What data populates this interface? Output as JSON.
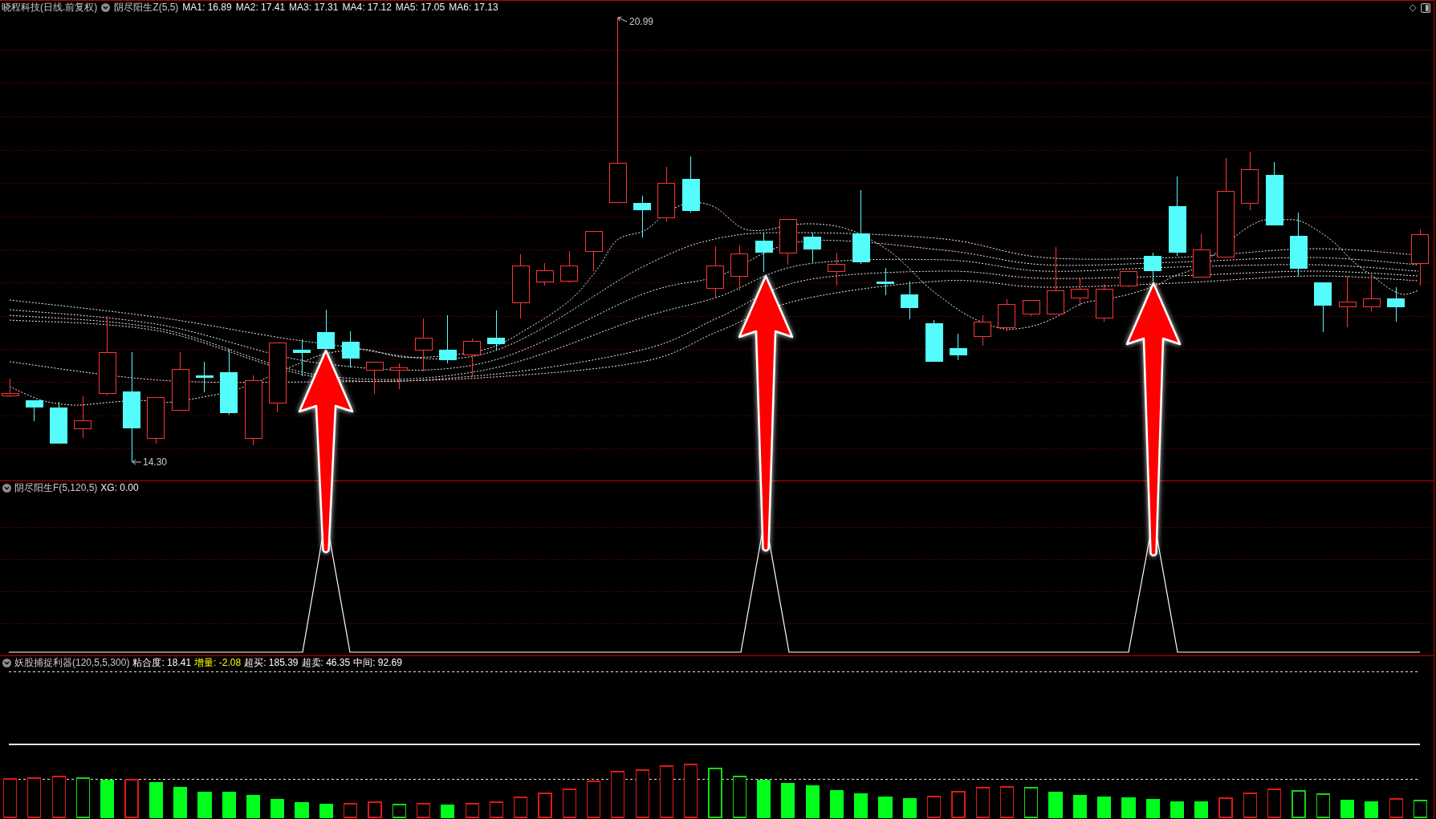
{
  "price_panel": {
    "title": "晓程科技(日线.前复权)",
    "indicator": "阴尽阳生Z(5,5)",
    "values": [
      {
        "label": "MA1: 16.89"
      },
      {
        "label": "MA2: 17.41"
      },
      {
        "label": "MA3: 17.31"
      },
      {
        "label": "MA4: 17.12"
      },
      {
        "label": "MA5: 17.05"
      },
      {
        "label": "MA6: 17.13"
      }
    ],
    "high_label": "20.99",
    "low_label": "14.30"
  },
  "signal_panel": {
    "indicator": "阴尽阳生F(5,120,5)",
    "values": [
      {
        "label": "XG: 0.00"
      }
    ]
  },
  "indicator_panel": {
    "indicator": "妖股捕捉利器(120,5,5,300)",
    "values": [
      {
        "label": "粘合度: 18.41",
        "color": "#ffffff"
      },
      {
        "label": "增量: -2.08",
        "color": "#ffff00"
      },
      {
        "label": "超买: 185.39",
        "color": "#ffffff"
      },
      {
        "label": "超卖: 46.35",
        "color": "#ffffff"
      },
      {
        "label": "中间: 92.69",
        "color": "#ffffff"
      }
    ]
  }
}
